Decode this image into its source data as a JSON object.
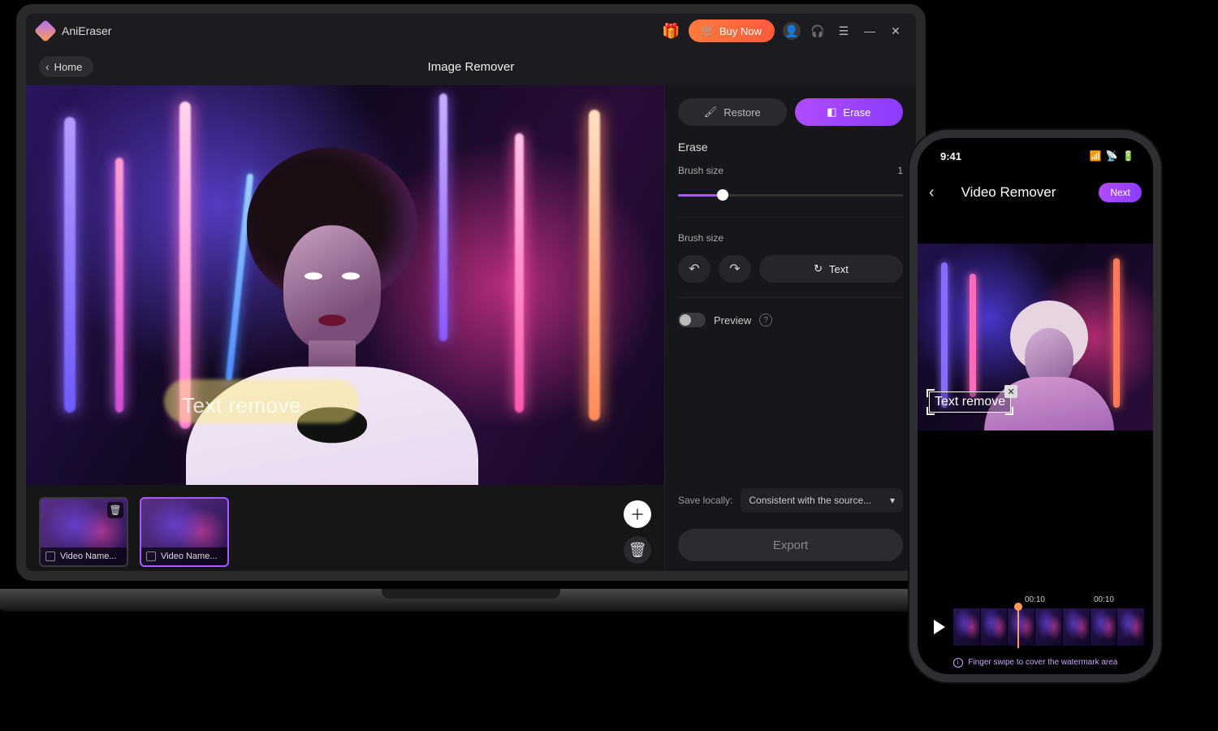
{
  "app": {
    "name": "AniEraser"
  },
  "topbar": {
    "buy_now": "Buy Now"
  },
  "subbar": {
    "home": "Home",
    "page_title": "Image Remover"
  },
  "canvas": {
    "overlay_text": "Text remove"
  },
  "thumbs": [
    {
      "label": "Video Name..."
    },
    {
      "label": "Video Name..."
    }
  ],
  "side": {
    "restore": "Restore",
    "erase": "Erase",
    "section_erase": "Erase",
    "brush_size_label": "Brush size",
    "brush_size_value": "1",
    "brush_size_label2": "Brush size",
    "text_btn": "Text",
    "preview": "Preview",
    "save_locally": "Save locally:",
    "save_option": "Consistent with the source...",
    "export": "Export"
  },
  "phone": {
    "time": "9:41",
    "title": "Video Remover",
    "next": "Next",
    "overlay_text": "Text remove",
    "time_a": "00:10",
    "time_b": "00:10",
    "tip": "Finger swipe to cover the watermark area"
  }
}
